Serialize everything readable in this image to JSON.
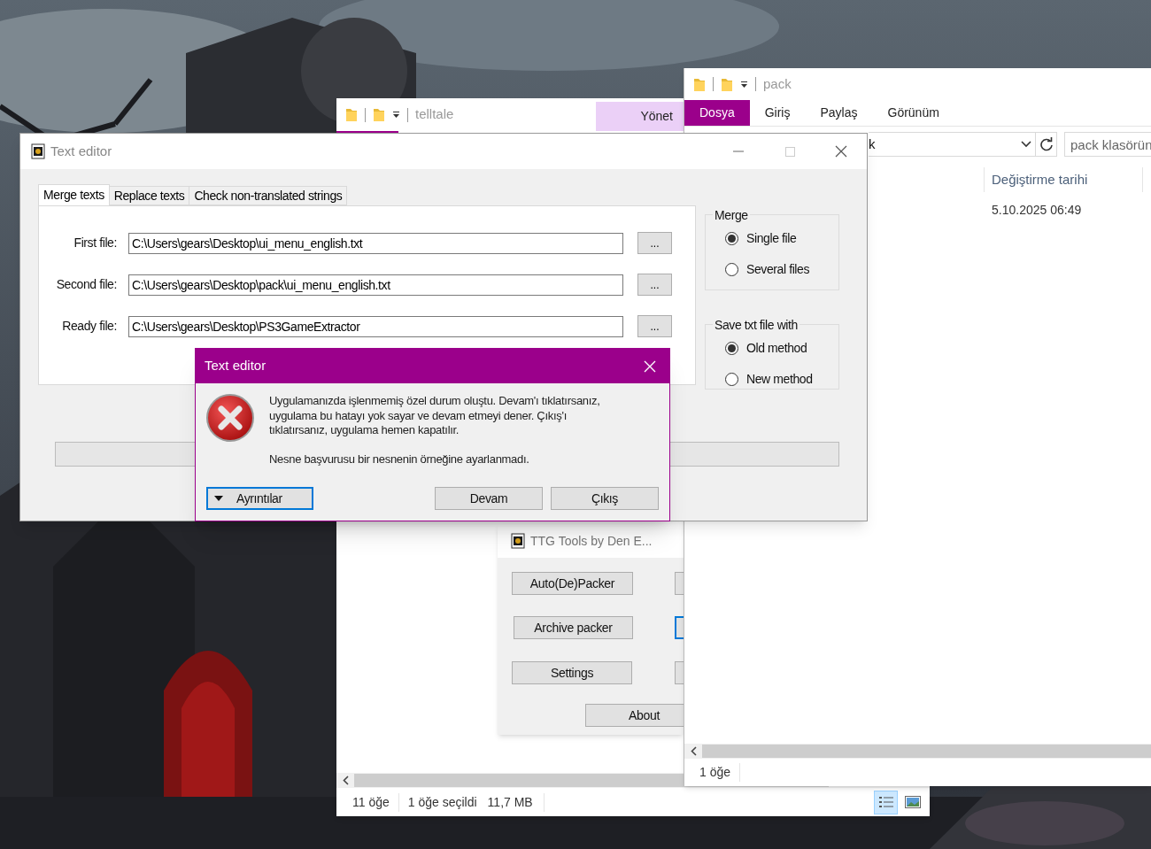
{
  "telltale_window": {
    "title": "telltale",
    "context_tab": "Yönet",
    "status_items": [
      "11 öğe",
      "1 öğe seçildi",
      "11,7 MB"
    ],
    "view_buttons": [
      {
        "kind": "details",
        "selected": true
      },
      {
        "kind": "large-icons",
        "selected": false
      }
    ]
  },
  "pack_window": {
    "title": "pack",
    "ribbon_tabs": [
      {
        "label": "Dosya",
        "selected": true
      },
      {
        "label": "Giriş",
        "selected": false
      },
      {
        "label": "Paylaş",
        "selected": false
      },
      {
        "label": "Görünüm",
        "selected": false
      }
    ],
    "address_text": "k",
    "search_placeholder": "pack klasörün",
    "columns": [
      "Değiştirme tarihi"
    ],
    "rows": [
      [
        "5.10.2025 06:49"
      ]
    ],
    "status_items": [
      "1 öğe"
    ]
  },
  "ttg_window": {
    "title": "TTG Tools by Den E...",
    "buttons": [
      {
        "label": "Auto(De)Packer"
      },
      {
        "label": "Archive packer"
      },
      {
        "label": "Settings"
      },
      {
        "label": "About"
      }
    ],
    "side_buttons": [
      {
        "focused": false
      },
      {
        "focused": true
      },
      {
        "focused": false
      }
    ]
  },
  "text_editor": {
    "title": "Text editor",
    "tabs": [
      {
        "label": "Merge texts",
        "selected": true
      },
      {
        "label": "Replace texts",
        "selected": false
      },
      {
        "label": "Check non-translated strings",
        "selected": false
      }
    ],
    "fields": [
      {
        "label": "First file:",
        "value": "C:\\Users\\gears\\Desktop\\ui_menu_english.txt",
        "button": "..."
      },
      {
        "label": "Second file:",
        "value": "C:\\Users\\gears\\Desktop\\pack\\ui_menu_english.txt",
        "button": "..."
      },
      {
        "label": "Ready file:",
        "value": "C:\\Users\\gears\\Desktop\\PS3GameExtractor",
        "button": "..."
      }
    ],
    "groups": [
      {
        "title": "Merge",
        "options": [
          {
            "label": "Single file",
            "selected": true
          },
          {
            "label": "Several files",
            "selected": false
          }
        ]
      },
      {
        "title": "Save txt file with",
        "options": [
          {
            "label": "Old method",
            "selected": true
          },
          {
            "label": "New method",
            "selected": false
          }
        ]
      }
    ],
    "progress": {
      "kind": "progress-bar"
    }
  },
  "dialog": {
    "title": "Text editor",
    "message": [
      "Uygulamanızda işlenmemiş özel durum oluştu. Devam'ı tıklatırsanız, uygulama bu hatayı yok sayar ve devam etmeyi dener. Çıkış'ı tıklatırsanız, uygulama hemen kapatılır.",
      "Nesne başvurusu bir nesnenin örneğine ayarlanmadı."
    ],
    "details_button": "Ayrıntılar",
    "buttons": [
      "Devam",
      "Çıkış"
    ]
  }
}
